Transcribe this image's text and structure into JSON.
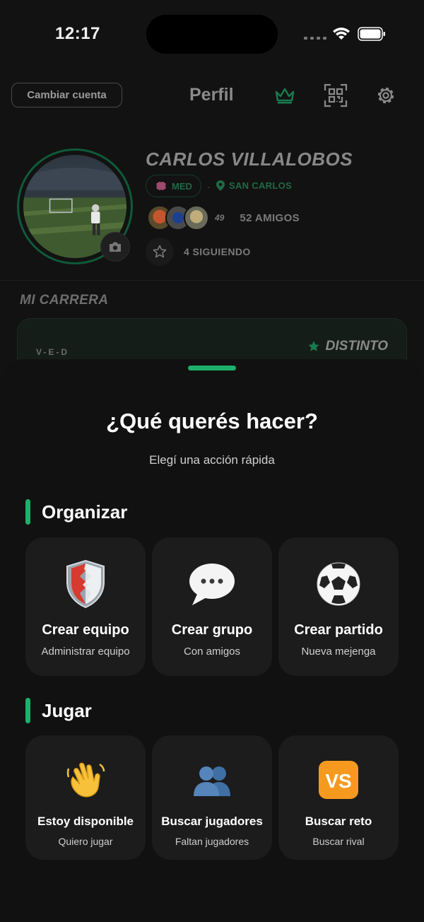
{
  "status_bar": {
    "time": "12:17"
  },
  "header": {
    "switch_account_label": "Cambiar cuenta",
    "title": "Perfil",
    "icons": [
      "crown-icon",
      "qr-code-icon",
      "gear-icon"
    ]
  },
  "profile": {
    "name": "CARLOS VILLALOBOS",
    "position": "MED",
    "location": "SAN CARLOS",
    "friends_extra": "49",
    "friends_count_label": "52 AMIGOS",
    "following_label": "4 SIGUIENDO"
  },
  "career": {
    "section_title": "MI CARRERA",
    "record_label": "V-E-D",
    "badge_label": "DISTINTO"
  },
  "sheet": {
    "title": "¿Qué querés hacer?",
    "subtitle": "Elegí una acción rápida",
    "sections": [
      {
        "title": "Organizar",
        "actions": [
          {
            "icon": "shield-icon",
            "title": "Crear equipo",
            "subtitle": "Administrar equipo"
          },
          {
            "icon": "speech-bubble-icon",
            "title": "Crear grupo",
            "subtitle": "Con amigos"
          },
          {
            "icon": "soccer-ball-icon",
            "title": "Crear partido",
            "subtitle": "Nueva mejenga"
          }
        ]
      },
      {
        "title": "Jugar",
        "actions": [
          {
            "icon": "waving-hand-icon",
            "title": "Estoy disponible",
            "subtitle": "Quiero jugar"
          },
          {
            "icon": "people-silhouette-icon",
            "title": "Buscar jugadores",
            "subtitle": "Faltan jugadores"
          },
          {
            "icon": "vs-icon",
            "title": "Buscar reto",
            "subtitle": "Buscar rival"
          }
        ]
      }
    ]
  },
  "colors": {
    "accent": "#1db06b",
    "sheet_bg": "#111111",
    "card_bg": "#1c1c1c"
  }
}
